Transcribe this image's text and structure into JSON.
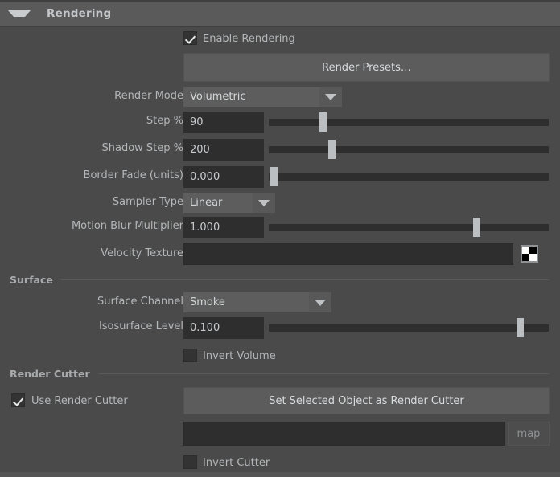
{
  "panel": {
    "title": "Rendering",
    "collapse_icon": "triangle-down-icon"
  },
  "enable_rendering": {
    "label": "Enable Rendering",
    "checked": true
  },
  "render_presets": {
    "label": "Render Presets…"
  },
  "render_mode": {
    "label": "Render Mode",
    "value": "Volumetric",
    "arrow_icon": "chevron-down-icon"
  },
  "step_pct": {
    "label": "Step %",
    "value": "90",
    "slider_fraction": 0.18
  },
  "shadow_step_pct": {
    "label": "Shadow Step %",
    "value": "200",
    "slider_fraction": 0.215
  },
  "border_fade": {
    "label": "Border Fade (units)",
    "value": "0.000",
    "slider_fraction": 0.008
  },
  "sampler_type": {
    "label": "Sampler Type",
    "value": "Linear",
    "arrow_icon": "chevron-down-icon"
  },
  "motion_blur_multiplier": {
    "label": "Motion Blur Multiplier",
    "value": "1.000",
    "slider_fraction": 0.735
  },
  "velocity_texture": {
    "label": "Velocity Texture",
    "value": "",
    "swatch_icon": "checkerboard-swatch-icon"
  },
  "surface_section": {
    "title": "Surface"
  },
  "surface_channel": {
    "label": "Surface Channel",
    "value": "Smoke",
    "arrow_icon": "chevron-down-icon"
  },
  "isosurface_level": {
    "label": "Isosurface Level",
    "value": "0.100",
    "slider_fraction": 0.885
  },
  "invert_volume": {
    "label": "Invert Volume",
    "checked": false
  },
  "render_cutter_section": {
    "title": "Render Cutter"
  },
  "use_render_cutter": {
    "label": "Use Render Cutter",
    "checked": true
  },
  "set_cutter_button": {
    "label": "Set Selected Object as Render Cutter"
  },
  "cutter_field": {
    "value": "",
    "map_label": "map"
  },
  "invert_cutter": {
    "label": "Invert Cutter",
    "checked": false
  },
  "colors": {
    "panel_bg": "#4a4a4a",
    "header_bg": "#5a5a5a",
    "field_bg": "#2e2e2e",
    "button_bg": "#5c5c5c",
    "text": "#b4b7b9",
    "handle": "#bcbfc1"
  }
}
